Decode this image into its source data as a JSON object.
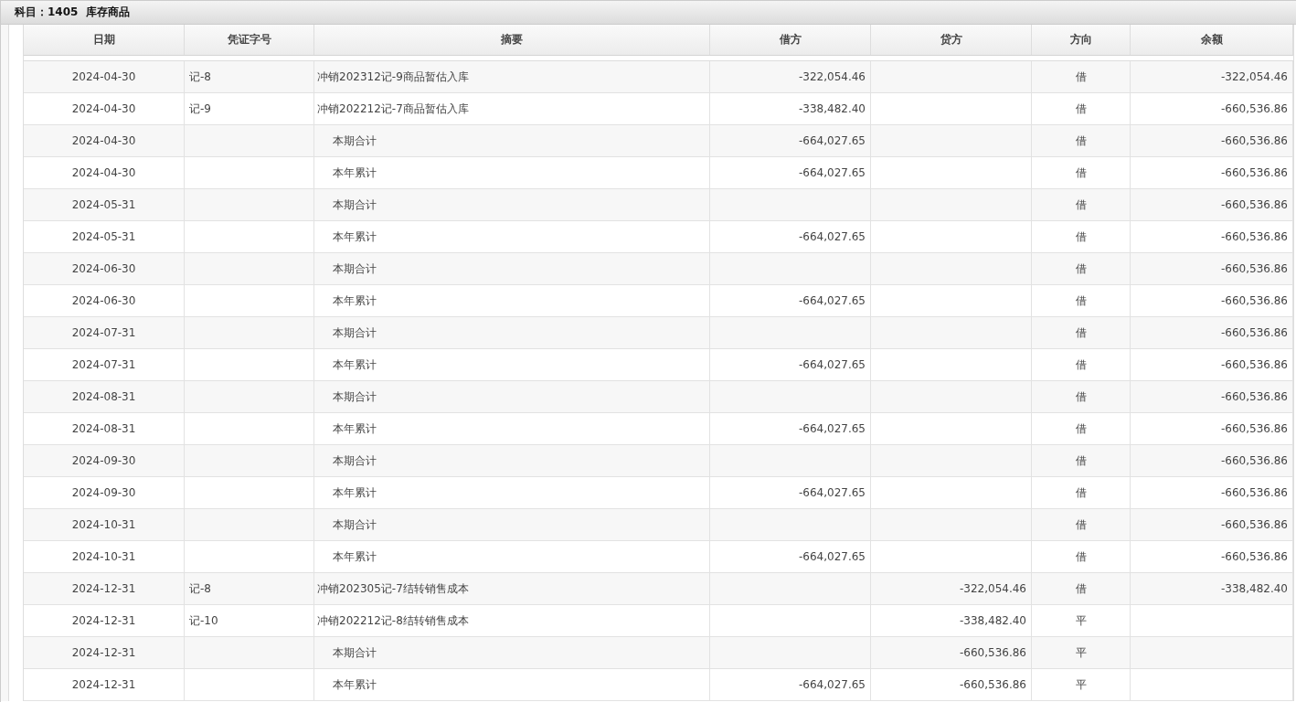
{
  "title": "科目：1405  库存商品",
  "columns": [
    "日期",
    "凭证字号",
    "摘要",
    "借方",
    "贷方",
    "方向",
    "余额"
  ],
  "rows": [
    {
      "kind": "entry",
      "date": "2024-04-30",
      "voucher": "记-8",
      "summary": "冲销202312记-9商品暂估入库",
      "debit": "-322,054.46",
      "credit": "",
      "direction": "借",
      "balance": "-322,054.46"
    },
    {
      "kind": "entry",
      "date": "2024-04-30",
      "voucher": "记-9",
      "summary": "冲销202212记-7商品暂估入库",
      "debit": "-338,482.40",
      "credit": "",
      "direction": "借",
      "balance": "-660,536.86"
    },
    {
      "kind": "total",
      "date": "2024-04-30",
      "voucher": "",
      "summary": "本期合计",
      "debit": "-664,027.65",
      "credit": "",
      "direction": "借",
      "balance": "-660,536.86"
    },
    {
      "kind": "total",
      "date": "2024-04-30",
      "voucher": "",
      "summary": "本年累计",
      "debit": "-664,027.65",
      "credit": "",
      "direction": "借",
      "balance": "-660,536.86"
    },
    {
      "kind": "total",
      "date": "2024-05-31",
      "voucher": "",
      "summary": "本期合计",
      "debit": "",
      "credit": "",
      "direction": "借",
      "balance": "-660,536.86"
    },
    {
      "kind": "total",
      "date": "2024-05-31",
      "voucher": "",
      "summary": "本年累计",
      "debit": "-664,027.65",
      "credit": "",
      "direction": "借",
      "balance": "-660,536.86"
    },
    {
      "kind": "total",
      "date": "2024-06-30",
      "voucher": "",
      "summary": "本期合计",
      "debit": "",
      "credit": "",
      "direction": "借",
      "balance": "-660,536.86"
    },
    {
      "kind": "total",
      "date": "2024-06-30",
      "voucher": "",
      "summary": "本年累计",
      "debit": "-664,027.65",
      "credit": "",
      "direction": "借",
      "balance": "-660,536.86"
    },
    {
      "kind": "total",
      "date": "2024-07-31",
      "voucher": "",
      "summary": "本期合计",
      "debit": "",
      "credit": "",
      "direction": "借",
      "balance": "-660,536.86"
    },
    {
      "kind": "total",
      "date": "2024-07-31",
      "voucher": "",
      "summary": "本年累计",
      "debit": "-664,027.65",
      "credit": "",
      "direction": "借",
      "balance": "-660,536.86"
    },
    {
      "kind": "total",
      "date": "2024-08-31",
      "voucher": "",
      "summary": "本期合计",
      "debit": "",
      "credit": "",
      "direction": "借",
      "balance": "-660,536.86"
    },
    {
      "kind": "total",
      "date": "2024-08-31",
      "voucher": "",
      "summary": "本年累计",
      "debit": "-664,027.65",
      "credit": "",
      "direction": "借",
      "balance": "-660,536.86"
    },
    {
      "kind": "total",
      "date": "2024-09-30",
      "voucher": "",
      "summary": "本期合计",
      "debit": "",
      "credit": "",
      "direction": "借",
      "balance": "-660,536.86"
    },
    {
      "kind": "total",
      "date": "2024-09-30",
      "voucher": "",
      "summary": "本年累计",
      "debit": "-664,027.65",
      "credit": "",
      "direction": "借",
      "balance": "-660,536.86"
    },
    {
      "kind": "total",
      "date": "2024-10-31",
      "voucher": "",
      "summary": "本期合计",
      "debit": "",
      "credit": "",
      "direction": "借",
      "balance": "-660,536.86"
    },
    {
      "kind": "total",
      "date": "2024-10-31",
      "voucher": "",
      "summary": "本年累计",
      "debit": "-664,027.65",
      "credit": "",
      "direction": "借",
      "balance": "-660,536.86"
    },
    {
      "kind": "entry",
      "date": "2024-12-31",
      "voucher": "记-8",
      "summary": "冲销202305记-7结转销售成本",
      "debit": "",
      "credit": "-322,054.46",
      "direction": "借",
      "balance": "-338,482.40"
    },
    {
      "kind": "entry",
      "date": "2024-12-31",
      "voucher": "记-10",
      "summary": "冲销202212记-8结转销售成本",
      "debit": "",
      "credit": "-338,482.40",
      "direction": "平",
      "balance": ""
    },
    {
      "kind": "total",
      "date": "2024-12-31",
      "voucher": "",
      "summary": "本期合计",
      "debit": "",
      "credit": "-660,536.86",
      "direction": "平",
      "balance": ""
    },
    {
      "kind": "total",
      "date": "2024-12-31",
      "voucher": "",
      "summary": "本年累计",
      "debit": "-664,027.65",
      "credit": "-660,536.86",
      "direction": "平",
      "balance": ""
    }
  ]
}
